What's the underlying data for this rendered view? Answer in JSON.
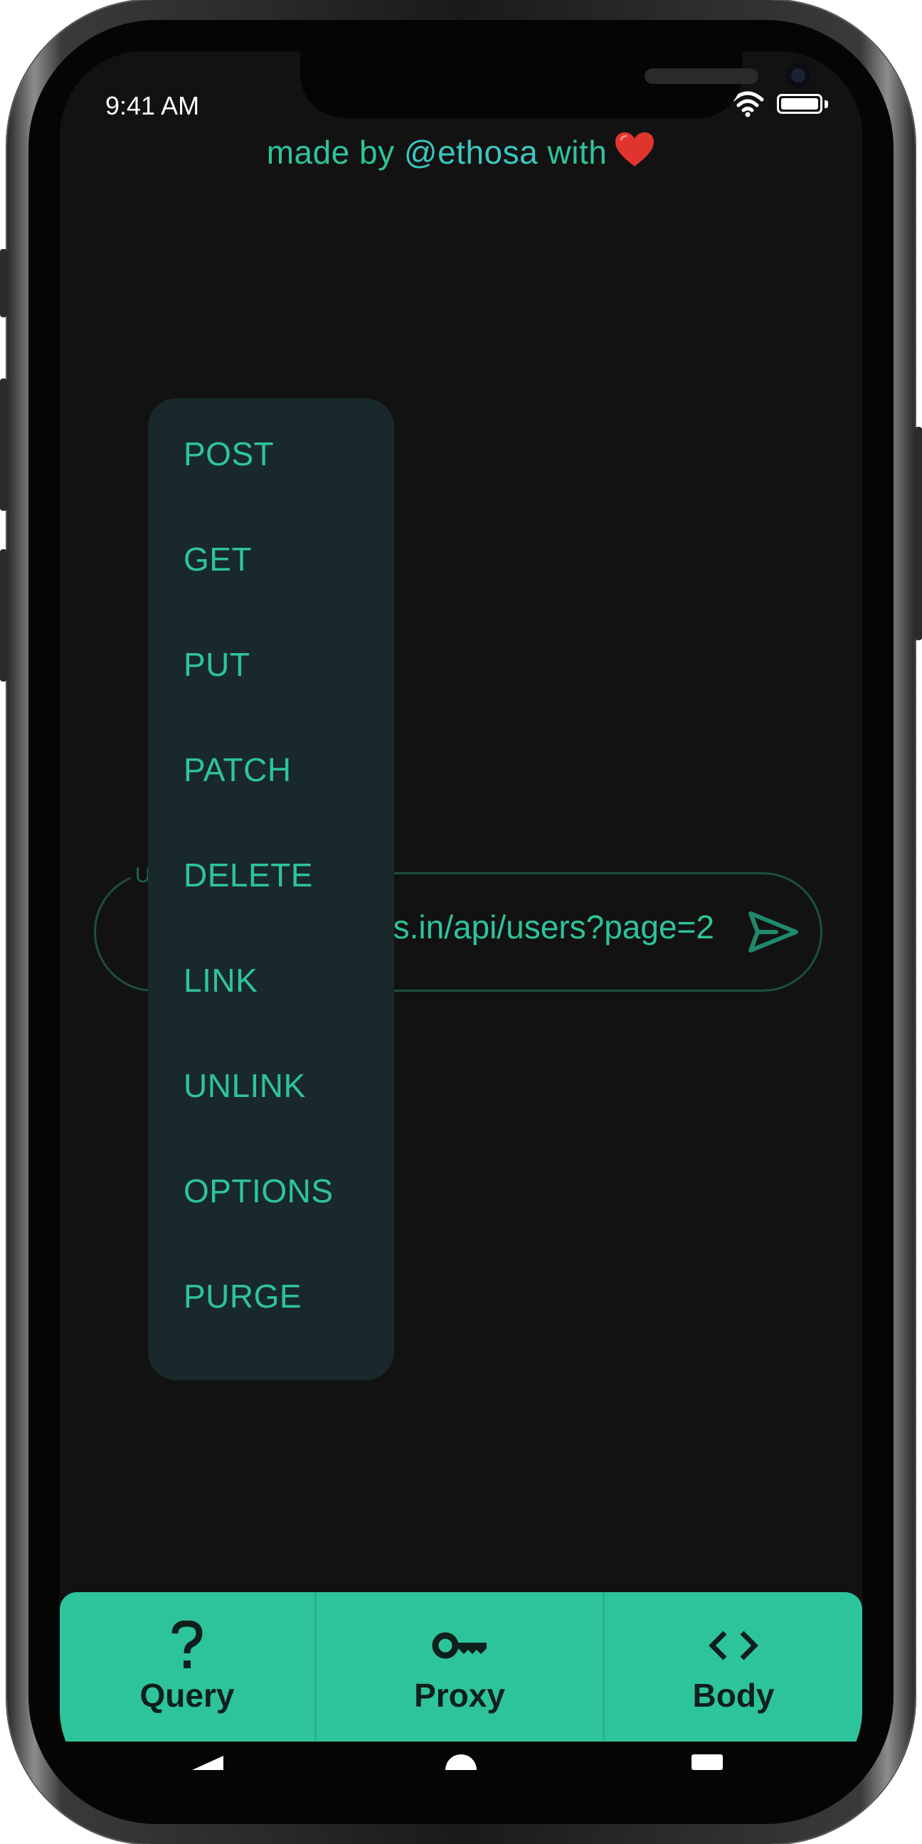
{
  "status_bar": {
    "time": "9:41 AM"
  },
  "credit": {
    "prefix": "made by ",
    "handle": "@ethosa",
    "suffix": " with"
  },
  "url_field": {
    "label": "U",
    "value": "https://reqres.in/api/users?page=2"
  },
  "method_menu": {
    "items": [
      "POST",
      "GET",
      "PUT",
      "PATCH",
      "DELETE",
      "LINK",
      "UNLINK",
      "OPTIONS",
      "PURGE"
    ]
  },
  "tabs": [
    {
      "label": "Query",
      "icon": "question-icon"
    },
    {
      "label": "Proxy",
      "icon": "key-icon"
    },
    {
      "label": "Body",
      "icon": "code-icon"
    }
  ],
  "colors": {
    "background": "#121212",
    "accent": "#2ec49b",
    "menu_background": "#19292b",
    "tabbar_text": "#0f1f1c"
  }
}
